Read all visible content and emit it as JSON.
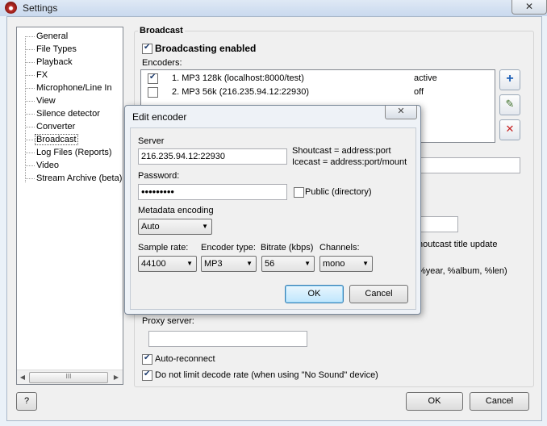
{
  "window": {
    "title": "Settings",
    "close_glyph": "✕"
  },
  "sidebar": {
    "items": [
      "General",
      "File Types",
      "Playback",
      "FX",
      "Microphone/Line In",
      "View",
      "Silence detector",
      "Converter",
      "Broadcast",
      "Log Files (Reports)",
      "Video",
      "Stream Archive (beta)"
    ],
    "selected": "Broadcast",
    "scroll_grip": "III",
    "scroll_left": "◀",
    "scroll_right": "▶"
  },
  "broadcast": {
    "section_title": "Broadcast",
    "enabled_label": "Broadcasting enabled",
    "enabled": true,
    "encoders_label": "Encoders:",
    "encoders": [
      {
        "name": "1. MP3 128k (localhost:8000/test)",
        "status": "active",
        "checked": true
      },
      {
        "name": "2. MP3 56k (216.235.94.12:22930)",
        "status": "off",
        "checked": false
      }
    ],
    "toolbar_icons": [
      "add-icon",
      "edit-icon",
      "delete-icon"
    ],
    "add_glyph": "+",
    "edit_glyph": "✎",
    "delete_glyph": "✕",
    "partial_title_update": "houtcast title update",
    "partial_tags": "%year, %album, %len)",
    "proxy_label": "Proxy server:",
    "proxy_value": "",
    "auto_reconnect_label": "Auto-reconnect",
    "auto_reconnect": true,
    "no_limit_label": "Do not limit decode rate (when using \"No Sound\" device)",
    "no_limit": true
  },
  "dialog": {
    "title": "Edit encoder",
    "close_glyph": "✕",
    "server_label": "Server",
    "server_value": "216.235.94.12:22930",
    "hint_shoutcast": "Shoutcast = address:port",
    "hint_icecast": "Icecast = address:port/mount",
    "password_label": "Password:",
    "password_value": "•••••••••",
    "public_label": "Public (directory)",
    "public": false,
    "metadata_label": "Metadata encoding",
    "metadata_value": "Auto",
    "sample_rate_label": "Sample rate:",
    "sample_rate_value": "44100",
    "encoder_type_label": "Encoder type:",
    "encoder_type_value": "MP3",
    "bitrate_label": "Bitrate (kbps)",
    "bitrate_value": "56",
    "channels_label": "Channels:",
    "channels_value": "mono",
    "ok_label": "OK",
    "cancel_label": "Cancel",
    "dropdown_glyph": "▼"
  },
  "footer": {
    "help_label": "?",
    "ok_label": "OK",
    "cancel_label": "Cancel"
  }
}
